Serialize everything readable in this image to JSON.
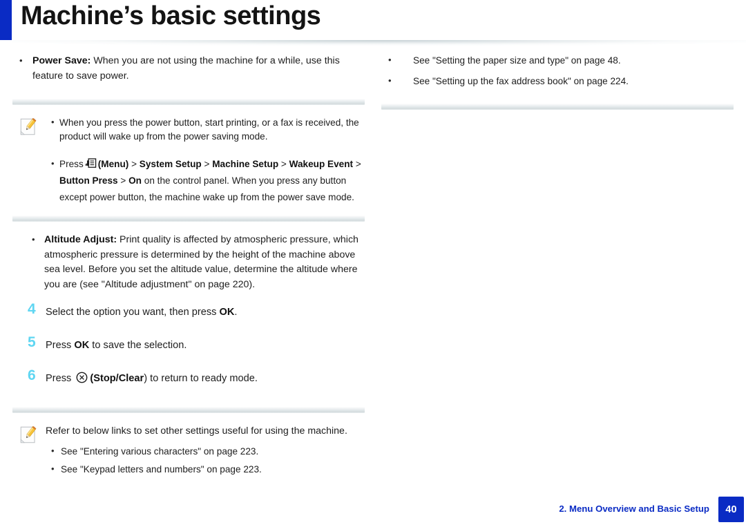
{
  "header": {
    "title": "Machine’s basic settings",
    "accent_color": "#0A2BC4"
  },
  "left_column": {
    "power_save": {
      "label": "Power Save:",
      "text": " When you are not using the machine for a while, use this feature to save power."
    },
    "note_power": {
      "icon": "note-pencil-icon",
      "lines": [
        "When you press the power button, start printing, or a fax is received, the product will wake up from the power saving mode."
      ],
      "press_line": {
        "press_word": "Press",
        "menu_icon": "menu-icon",
        "menu_label": "(Menu)",
        "sep": " > ",
        "crumb1": "System Setup",
        "crumb2": "Machine Setup",
        "crumb3": "Wakeup Event",
        "crumb4": "Button Press",
        "crumb5": "On",
        "tail": " on the control panel. When you press any button except power button, the machine wake up from the power save mode."
      }
    },
    "altitude": {
      "label": "Altitude Adjust:",
      "text": " Print quality is affected by atmospheric pressure, which atmospheric pressure is determined by the height of the machine above sea level. Before you set the altitude value, determine the altitude where you are  (see \"Altitude adjustment\" on page 220)."
    },
    "steps": [
      {
        "number": "4",
        "prefix": "Select the option you want, then press ",
        "bold": "OK",
        "suffix": "."
      },
      {
        "number": "5",
        "prefix": "Press ",
        "bold": "OK",
        "suffix": " to save the selection."
      },
      {
        "number": "6",
        "prefix": "Press ",
        "icon": "stop-clear-icon",
        "bold_paren_open": "(",
        "bold": "Stop/Clear",
        "suffix": ") to return to ready mode."
      }
    ],
    "note_links": {
      "icon": "note-pencil-icon",
      "intro": "Refer to below links to set other settings useful for using the machine.",
      "items": [
        "See \"Entering various characters\" on page 223.",
        "See \"Keypad letters and numbers\" on page 223."
      ]
    }
  },
  "right_column": {
    "items": [
      "See \"Setting the paper size and type\" on page 48.",
      "See \"Setting up the fax address book\" on page 224."
    ]
  },
  "footer": {
    "chapter": "2.  Menu Overview and Basic Setup",
    "page_number": "40",
    "accent_color": "#0A2BC4"
  }
}
